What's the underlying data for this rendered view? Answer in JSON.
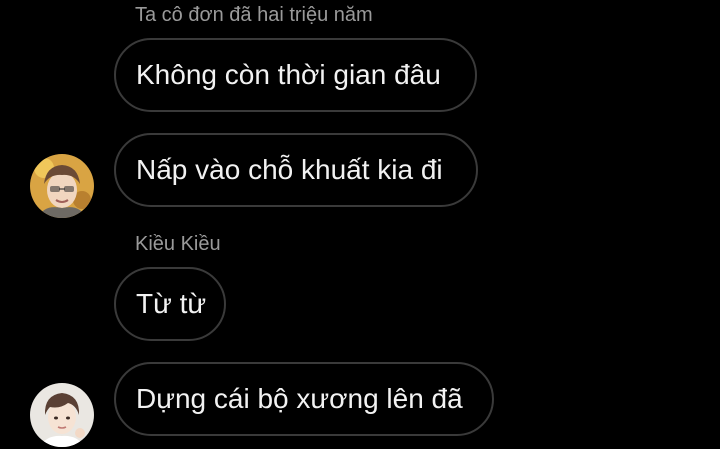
{
  "messages": [
    {
      "sender": "Ta cô đơn đã hai triệu năm",
      "text": "Không còn thời gian đâu"
    },
    {
      "text": "Nấp vào chỗ khuất kia đi"
    },
    {
      "sender": "Kiều Kiều",
      "text": "Từ từ"
    },
    {
      "text": "Dựng cái bộ xương lên đã"
    }
  ],
  "icons": {
    "avatar_1": "avatar-icon",
    "avatar_2": "avatar-icon"
  },
  "colors": {
    "background": "#000000",
    "bubble_border": "#3a3a3a",
    "message_text": "#f2f2f2",
    "sender_text": "#9a9a9a"
  }
}
